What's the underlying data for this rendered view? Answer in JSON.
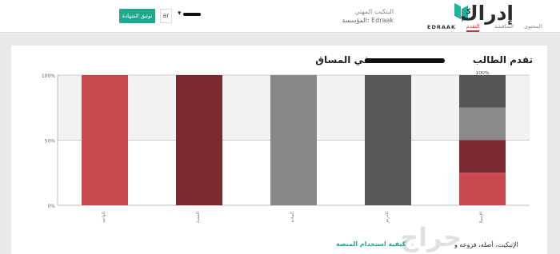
{
  "header": {
    "brand_ar": "إدراك",
    "brand_en": "EDRAAK",
    "course_title": "البتكيت المهني",
    "course_org": "المؤسسة: Edraak",
    "apply_label": "توثيق الشهادة",
    "lang_value": "ar"
  },
  "tabs": [
    {
      "label": "المحتوى",
      "active": false
    },
    {
      "label": "المناقشة",
      "active": false
    },
    {
      "label": "التقدم",
      "active": true
    }
  ],
  "content": {
    "title": "تقدم الطالب",
    "title_suffix": "في المساق",
    "footer_link": "كيفية استخدام المنصة",
    "footer_text": "الإتيكيت، أصله، فروعه و"
  },
  "chart_data": {
    "type": "bar",
    "y_ticks": [
      "100%",
      "50%",
      "0%"
    ],
    "top_label": "100%",
    "bars": [
      {
        "label": "الإجمالي",
        "stack": [
          25,
          25,
          25,
          25
        ],
        "colors": [
          "#c94a4e",
          "#7a2a2f",
          "#8a8a8a",
          "#565656"
        ]
      },
      {
        "label": "الدرس",
        "value": 100,
        "color": "#575757"
      },
      {
        "label": "المادة",
        "value": 100,
        "color": "#878787"
      },
      {
        "label": "المشاركة",
        "value": 100,
        "color": "#7b2a2e"
      },
      {
        "label": "الواجب",
        "value": 100,
        "color": "#c94a4e"
      }
    ]
  },
  "watermark": "حراج"
}
